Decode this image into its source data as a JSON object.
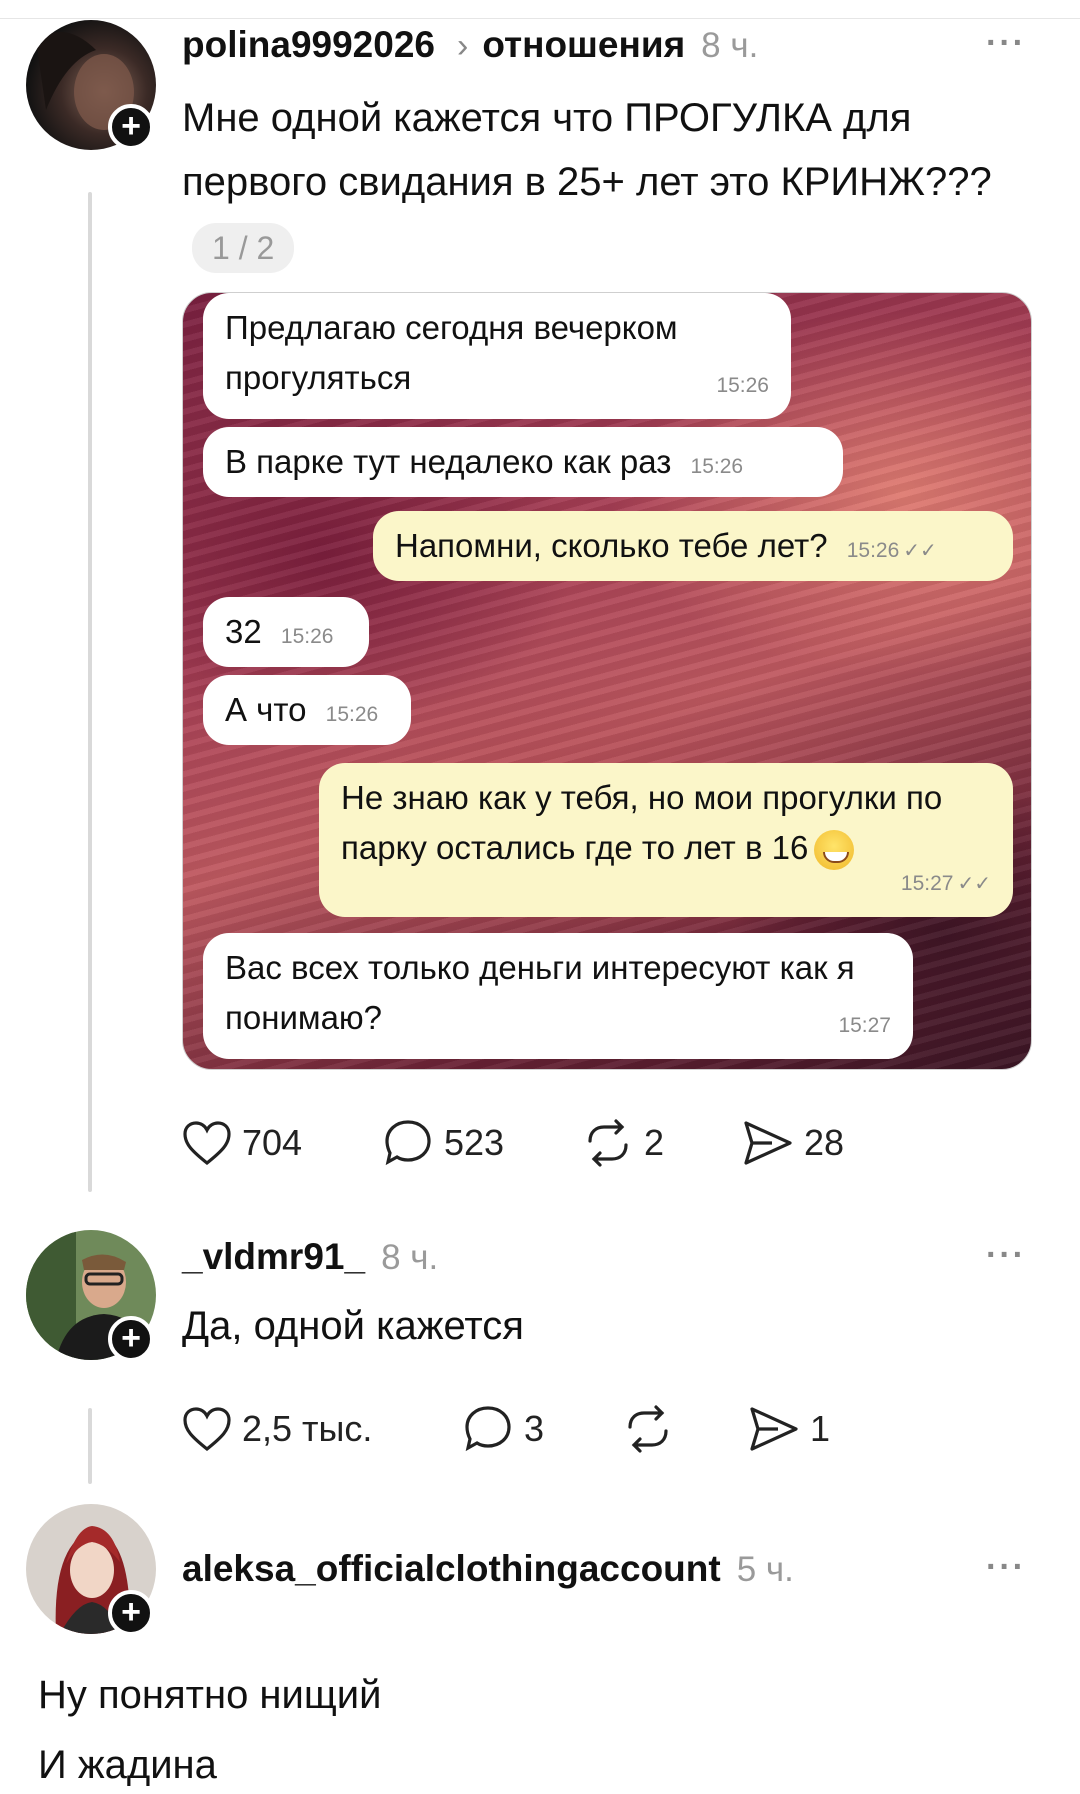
{
  "post": {
    "username": "polina9992026",
    "topic": "отношения",
    "time": "8 ч.",
    "text": "Мне одной кажется что ПРОГУЛКА для первого свидания в 25+ лет это КРИНЖ???",
    "page_badge": "1 / 2",
    "chat": [
      {
        "text": "Предлагаю сегодня вечерком прогуляться",
        "time": "15:26",
        "side": "in"
      },
      {
        "text": "В парке тут недалеко как раз",
        "time": "15:26",
        "side": "in"
      },
      {
        "text": "Напомни, сколько тебе лет?",
        "time": "15:26",
        "side": "out"
      },
      {
        "text": "32",
        "time": "15:26",
        "side": "in"
      },
      {
        "text": "А что",
        "time": "15:26",
        "side": "in"
      },
      {
        "text": "Не знаю как у тебя, но мои прогулки по парку остались где то лет в 16",
        "time": "15:27",
        "side": "out"
      },
      {
        "text": "Вас всех только деньги интересуют как я понимаю?",
        "time": "15:27",
        "side": "in"
      }
    ],
    "likes": "704",
    "comments": "523",
    "reposts": "2",
    "shares": "28"
  },
  "reply1": {
    "username": "_vldmr91_",
    "time": "8 ч.",
    "text": "Да, одной кажется",
    "likes": "2,5 тыс.",
    "comments": "3",
    "shares": "1"
  },
  "reply2": {
    "username": "aleksa_officialclothingaccount",
    "time": "5 ч.",
    "text_line1": "Ну понятно нищий",
    "text_line2": "И жадина"
  },
  "more_label": "···",
  "plus_label": "+"
}
